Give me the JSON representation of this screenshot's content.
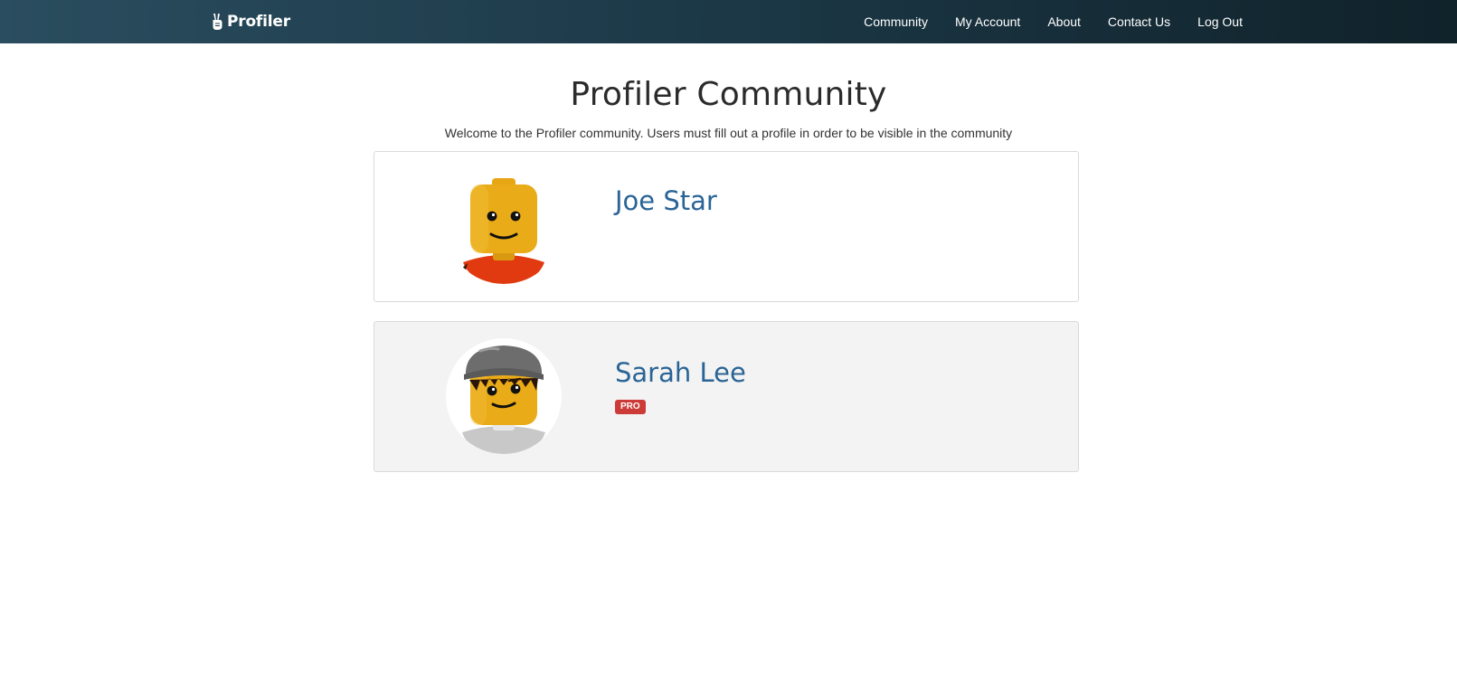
{
  "nav": {
    "brand": "Profiler",
    "links": [
      "Community",
      "My Account",
      "About",
      "Contact Us",
      "Log Out"
    ]
  },
  "page": {
    "title": "Profiler Community",
    "subtitle": "Welcome to the Profiler community. Users must fill out a profile in order to be visible in the community"
  },
  "members": [
    {
      "name": "Joe Star",
      "avatar": "lego-minifig-orange-torso"
    },
    {
      "name": "Sarah Lee",
      "avatar": "lego-minifig-gray-hat",
      "badge": "PRO"
    }
  ],
  "colors": {
    "navbar_start": "#2a4d5f",
    "navbar_end": "#10222a",
    "link": "#2a6496",
    "badge": "#cc3b37",
    "card_highlight": "#f3f3f3"
  }
}
